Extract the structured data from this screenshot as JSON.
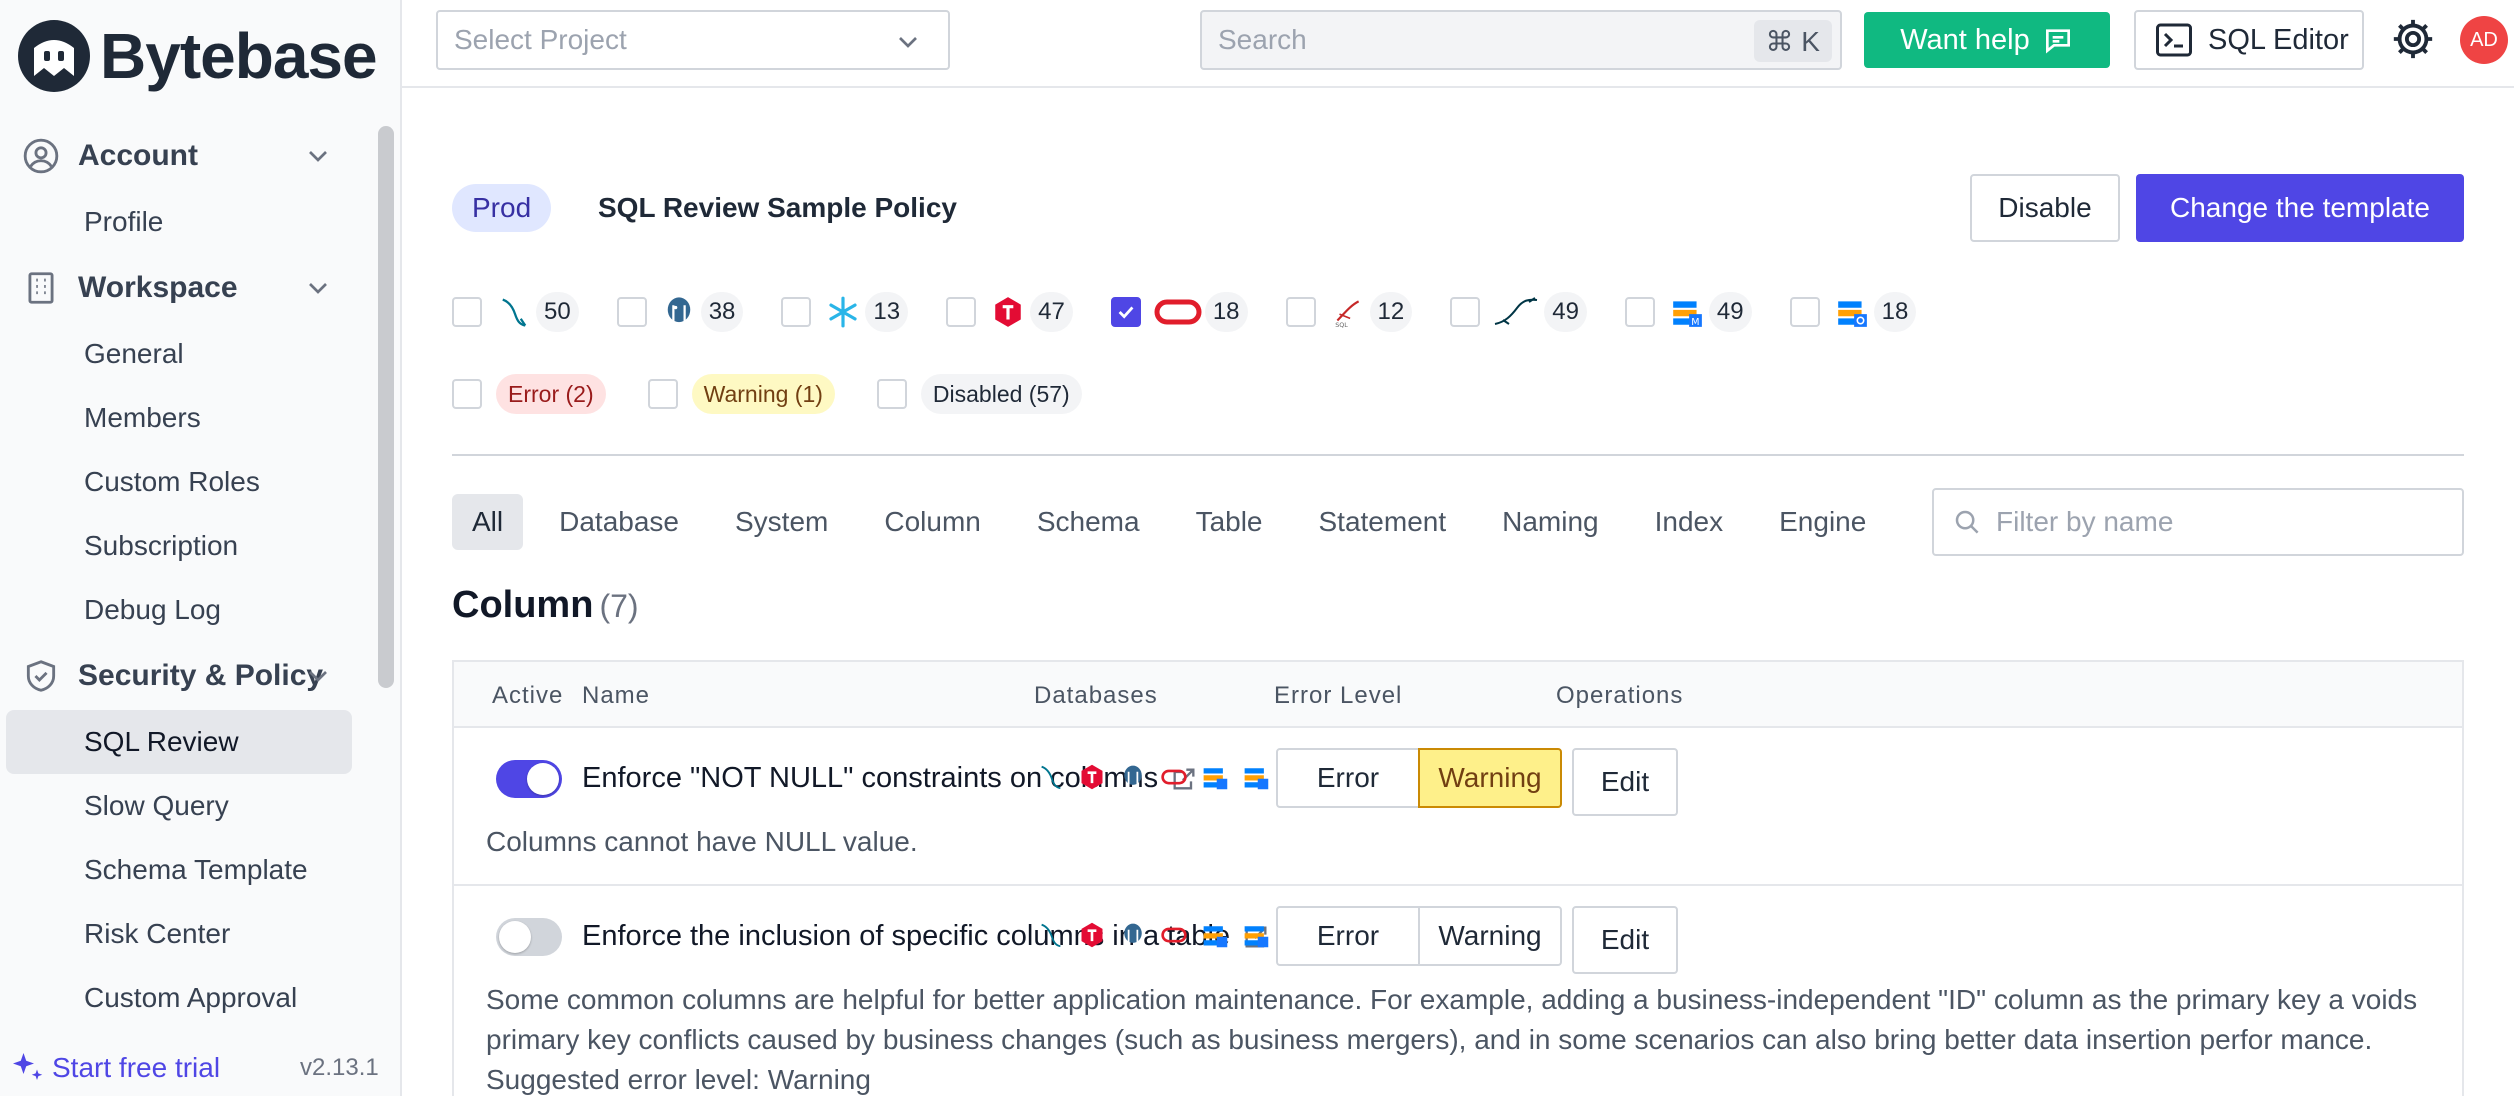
{
  "brand": {
    "name": "Bytebase"
  },
  "sidebar": {
    "groups": [
      {
        "label": "Account",
        "icon": "user-circle-icon",
        "items": [
          "Profile"
        ]
      },
      {
        "label": "Workspace",
        "icon": "building-icon",
        "items": [
          "General",
          "Members",
          "Custom Roles",
          "Subscription",
          "Debug Log"
        ]
      },
      {
        "label": "Security & Policy",
        "icon": "shield-icon",
        "items": [
          "SQL Review",
          "Slow Query",
          "Schema Template",
          "Risk Center",
          "Custom Approval"
        ]
      }
    ],
    "active_item": "SQL Review",
    "trial_label": "Start free trial",
    "version": "v2.13.1"
  },
  "topbar": {
    "project_placeholder": "Select Project",
    "search_placeholder": "Search",
    "search_shortcut": "⌘ K",
    "help_label": "Want help",
    "sql_editor_label": "SQL Editor",
    "avatar_initials": "AD"
  },
  "policy": {
    "environment": "Prod",
    "title": "SQL Review Sample Policy",
    "disable_label": "Disable",
    "change_template_label": "Change the template"
  },
  "engines": [
    {
      "name": "mysql-icon",
      "count": "50",
      "checked": false
    },
    {
      "name": "postgresql-icon",
      "count": "38",
      "checked": false
    },
    {
      "name": "snowflake-icon",
      "count": "13",
      "checked": false
    },
    {
      "name": "tidb-icon",
      "count": "47",
      "checked": false
    },
    {
      "name": "oracle-icon",
      "count": "18",
      "checked": true
    },
    {
      "name": "sqlserver-icon",
      "count": "12",
      "checked": false
    },
    {
      "name": "mariadb-icon",
      "count": "49",
      "checked": false
    },
    {
      "name": "oceanbase-mysql-icon",
      "count": "49",
      "checked": false
    },
    {
      "name": "oceanbase-oracle-icon",
      "count": "18",
      "checked": false
    }
  ],
  "levels": [
    {
      "label": "Error (2)",
      "kind": "err"
    },
    {
      "label": "Warning (1)",
      "kind": "warn"
    },
    {
      "label": "Disabled (57)",
      "kind": "dis"
    }
  ],
  "tabs": [
    "All",
    "Database",
    "System",
    "Column",
    "Schema",
    "Table",
    "Statement",
    "Naming",
    "Index",
    "Engine"
  ],
  "active_tab": "All",
  "filter_placeholder": "Filter by name",
  "section": {
    "title": "Column",
    "count": "(7)"
  },
  "table": {
    "headers": {
      "active": "Active",
      "name": "Name",
      "databases": "Databases",
      "level": "Error Level",
      "ops": "Operations"
    },
    "error_label": "Error",
    "warning_label": "Warning",
    "edit_label": "Edit",
    "rows": [
      {
        "active": true,
        "name": "Enforce \"NOT NULL\" constraints on columns",
        "level": "Warning",
        "description": "Columns cannot have NULL value."
      },
      {
        "active": false,
        "name": "Enforce the inclusion of specific columns in a table",
        "level": "",
        "description": "Some common columns are helpful for better application maintenance. For example, adding a business-independent \"ID\" column as the primary key a voids primary key conflicts caused by business changes (such as business mergers), and in some scenarios can also bring better data insertion perfor mance. Suggested error level: Warning"
      }
    ]
  },
  "colors": {
    "primary": "#4f46e5",
    "success": "#10b981",
    "avatar": "#ef4444"
  }
}
